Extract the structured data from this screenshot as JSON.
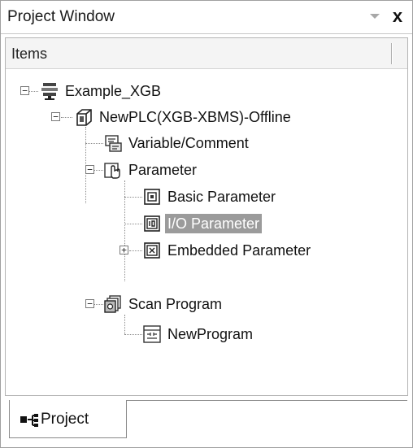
{
  "window": {
    "title": "Project Window",
    "close_glyph": "x"
  },
  "items_header": "Items",
  "tree": {
    "root": {
      "label": "Example_XGB",
      "icon": "network-icon",
      "expanded": true
    },
    "plc": {
      "label": "NewPLC(XGB-XBMS)-Offline",
      "icon": "plc-icon",
      "expanded": true
    },
    "variable": {
      "label": "Variable/Comment",
      "icon": "variable-comment-icon"
    },
    "parameter": {
      "label": "Parameter",
      "icon": "parameter-hand-icon",
      "expanded": true
    },
    "basic_param": {
      "label": "Basic Parameter",
      "icon": "basic-parameter-icon"
    },
    "io_param": {
      "label": "I/O Parameter",
      "icon": "io-parameter-icon",
      "selected": true
    },
    "embedded_param": {
      "label": "Embedded Parameter",
      "icon": "embedded-parameter-icon",
      "expanded": false
    },
    "scan_program": {
      "label": "Scan Program",
      "icon": "scan-program-icon",
      "expanded": true
    },
    "new_program": {
      "label": "NewProgram",
      "icon": "ladder-program-icon"
    }
  },
  "tabs": [
    {
      "label": "Project",
      "icon": "project-tab-icon",
      "active": true
    }
  ],
  "colors": {
    "selection": "#9b9b9b",
    "border": "#a0a0a0"
  }
}
